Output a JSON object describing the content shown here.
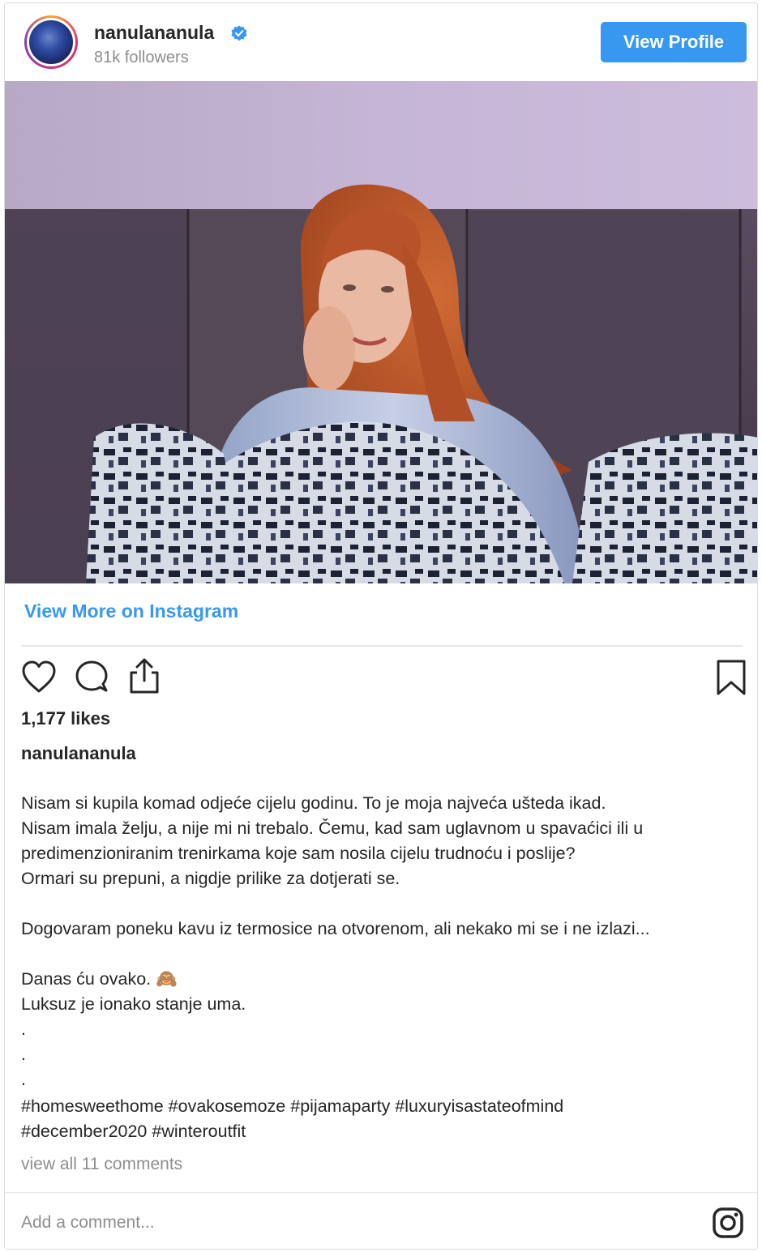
{
  "header": {
    "username": "nanulananula",
    "followers": "81k followers",
    "view_profile_label": "View Profile"
  },
  "post": {
    "view_more_label": "View More on Instagram",
    "likes": "1,177 likes",
    "caption_username": "nanulananula",
    "caption_lines": [
      "Nisam si kupila komad odjeće cijelu godinu. To je moja najveća ušteda ikad.",
      "Nisam imala želju, a nije mi ni trebalo. Čemu, kad sam uglavnom u spavaćici ili u",
      "predimenzioniranim trenirkama koje sam nosila cijelu trudnoću i poslije?",
      "Ormari su prepuni, a nigdje prilike za dotjerati se.",
      "Dogovaram poneku kavu iz termosice na otvorenom, ali nekako mi se i ne izlazi...",
      "Danas ću ovako. 🙈",
      "Luksuz je ionako stanje uma.",
      ".",
      ".",
      "."
    ],
    "hashtag_lines": [
      "#homesweethome #ovakosemoze #pijamaparty #luxuryisastateofmind",
      "#december2020 #winteroutfit"
    ],
    "view_comments": "view all 11 comments",
    "add_comment_placeholder": "Add a comment..."
  },
  "colors": {
    "accent": "#3897f0",
    "muted_text": "#8e8e8e",
    "border": "#dbdbdb"
  },
  "icons": [
    "verified-badge-icon",
    "heart-icon",
    "comment-icon",
    "share-icon",
    "bookmark-icon",
    "instagram-icon"
  ]
}
